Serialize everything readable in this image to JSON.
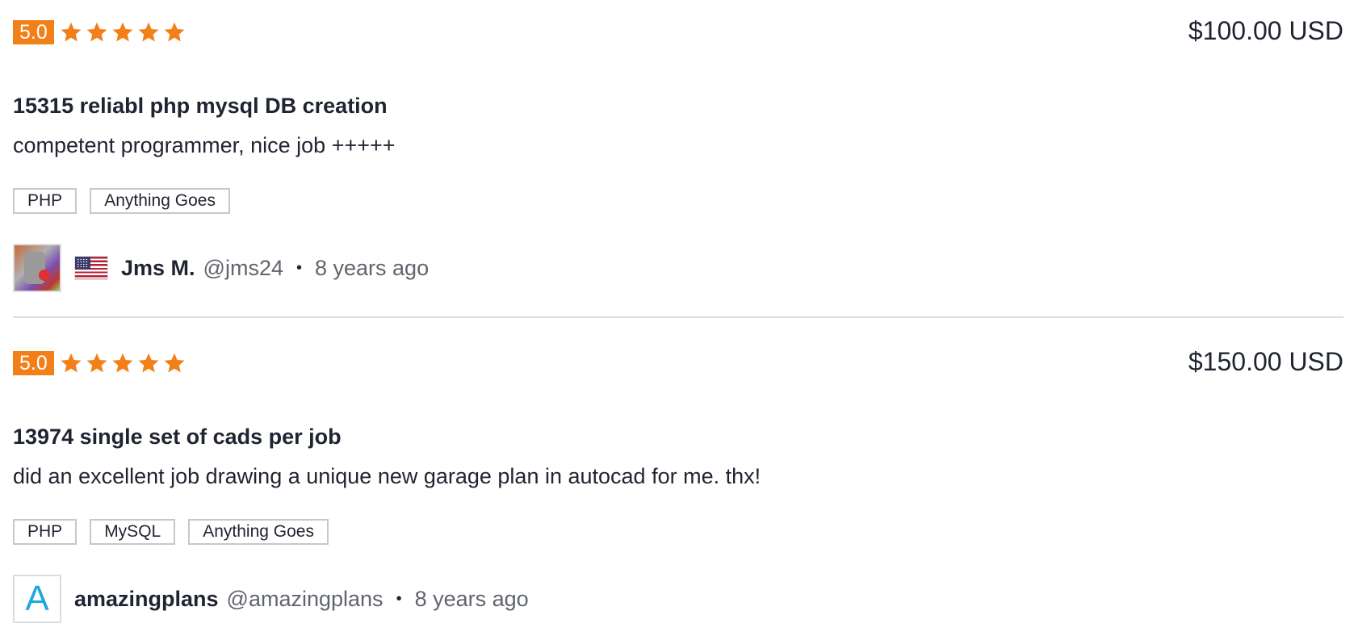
{
  "colors": {
    "rating_badge_bg": "#f37f18",
    "star": "#f37f18",
    "avatar_letter": "#1ea7e1",
    "divider": "#dedede"
  },
  "reviews": [
    {
      "rating": "5.0",
      "star_count": 5,
      "price": "$100.00 USD",
      "title": "15315 reliabl php mysql DB creation",
      "comment": "competent programmer, nice job +++++",
      "tags": [
        "PHP",
        "Anything Goes"
      ],
      "user": {
        "avatar_icon": "user-photo-avatar",
        "flag_icon": "us-flag-icon",
        "name": "Jms M.",
        "handle": "@jms24"
      },
      "separator": "•",
      "time": "8 years ago"
    },
    {
      "rating": "5.0",
      "star_count": 5,
      "price": "$150.00 USD",
      "title": "13974 single set of cads per job",
      "comment": "did an excellent job drawing a unique new garage plan in autocad for me. thx!",
      "tags": [
        "PHP",
        "MySQL",
        "Anything Goes"
      ],
      "user": {
        "avatar_letter": "A",
        "name": "amazingplans",
        "handle": "@amazingplans"
      },
      "separator": "•",
      "time": "8 years ago"
    }
  ]
}
